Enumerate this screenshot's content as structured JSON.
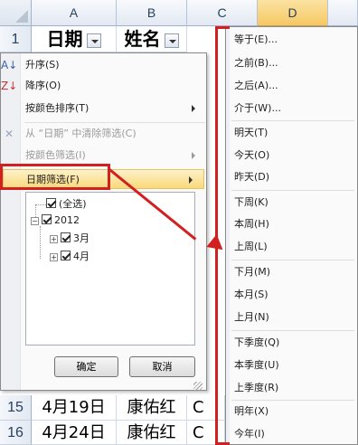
{
  "columns": [
    "A",
    "B",
    "C",
    "D"
  ],
  "header_row": {
    "row_num": "1",
    "a": "日期",
    "b": "姓名"
  },
  "data_rows": [
    {
      "row_num": "15",
      "a": "4月19日",
      "b": "康佑红",
      "c": "C"
    },
    {
      "row_num": "16",
      "a": "4月24日",
      "b": "康佑红",
      "c": "C"
    }
  ],
  "menu": {
    "sort_asc": "升序(S)",
    "sort_desc": "降序(O)",
    "sort_by_color": "按颜色排序(T)",
    "clear_filter": "从 “日期” 中清除筛选(C)",
    "filter_by_color": "按颜色筛选(I)",
    "date_filter": "日期筛选(F)"
  },
  "tree": {
    "select_all": "(全选)",
    "year": "2012",
    "month1": "3月",
    "month2": "4月"
  },
  "buttons": {
    "ok": "确定",
    "cancel": "取消"
  },
  "submenu": [
    "等于(E)...",
    "之前(B)...",
    "之后(A)...",
    "介于(W)...",
    "明天(T)",
    "今天(O)",
    "昨天(D)",
    "下周(K)",
    "本周(H)",
    "上周(L)",
    "下月(M)",
    "本月(S)",
    "上月(N)",
    "下季度(Q)",
    "本季度(U)",
    "上季度(R)",
    "明年(X)",
    "今年(I)"
  ],
  "colors": {
    "annotation": "#d21f1f",
    "highlight": "#f9d97a"
  }
}
